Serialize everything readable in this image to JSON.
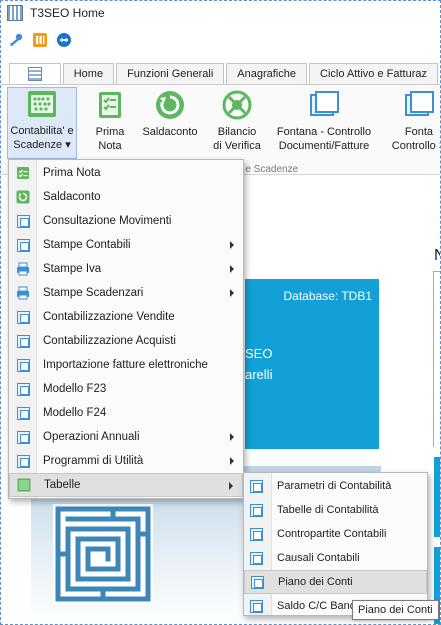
{
  "window": {
    "title": "T3SEO Home"
  },
  "quick_access": [
    {
      "icon": "key-icon"
    },
    {
      "icon": "bookmarks-icon"
    },
    {
      "icon": "remote-assistance-icon"
    }
  ],
  "ribbon_tabs": [
    {
      "label": "Home"
    },
    {
      "label": "Funzioni Generali"
    },
    {
      "label": "Anagrafiche"
    },
    {
      "label": "Ciclo Attivo e Fatturaz"
    }
  ],
  "ribbon": {
    "buttons": [
      {
        "line1": "Contabilita' e",
        "line2": "Scadenze ▾",
        "icon": "abacus-icon",
        "active": true
      },
      {
        "line1": "Prima",
        "line2": "Nota",
        "icon": "checklist-icon"
      },
      {
        "line1": "Saldaconto",
        "line2": "",
        "icon": "refresh-circle-icon"
      },
      {
        "line1": "Bilancio",
        "line2": "di Verifica",
        "icon": "balance-icon"
      },
      {
        "line1": "Fontana - Controllo",
        "line2": "Documenti/Fatture",
        "icon": "window-icon"
      },
      {
        "line1": "Fonta",
        "line2": "Controllo S",
        "icon": "window-icon"
      }
    ],
    "group_label": "a e Scadenze"
  },
  "background": {
    "database_label": "Database: TDB1",
    "card_line1": "SEO",
    "card_line2": "arelli",
    "right_letter": "N"
  },
  "menu": {
    "items": [
      {
        "label": "Prima Nota",
        "icon": "checklist-icon",
        "submenu": false
      },
      {
        "label": "Saldaconto",
        "icon": "refresh-circle-icon",
        "submenu": false
      },
      {
        "label": "Consultazione Movimenti",
        "icon": "window-icon",
        "submenu": false
      },
      {
        "label": "Stampe Contabili",
        "icon": "window-icon",
        "submenu": true
      },
      {
        "label": "Stampe Iva",
        "icon": "printer-icon",
        "submenu": true
      },
      {
        "label": "Stampe Scadenzari",
        "icon": "printer-icon",
        "submenu": true
      },
      {
        "label": "Contabilizzazione Vendite",
        "icon": "window-icon",
        "submenu": false
      },
      {
        "label": "Contabilizzazione Acquisti",
        "icon": "window-icon",
        "submenu": false
      },
      {
        "label": "Importazione fatture elettroniche",
        "icon": "window-icon",
        "submenu": false
      },
      {
        "label": "Modello F23",
        "icon": "window-icon",
        "submenu": false
      },
      {
        "label": "Modello F24",
        "icon": "window-icon",
        "submenu": false
      },
      {
        "label": "Operazioni Annuali",
        "icon": "window-icon",
        "submenu": true
      },
      {
        "label": "Programmi di Utilità",
        "icon": "window-icon",
        "submenu": true
      },
      {
        "label": "Tabelle",
        "icon": "table-icon",
        "submenu": true,
        "highlight": true
      }
    ]
  },
  "submenu": {
    "items": [
      {
        "label": "Parametri di Contabilità",
        "icon": "window-icon"
      },
      {
        "label": "Tabelle di Contabilità",
        "icon": "window-icon"
      },
      {
        "label": "Contropartite Contabili",
        "icon": "window-icon"
      },
      {
        "label": "Causali Contabili",
        "icon": "window-icon"
      },
      {
        "label": "Piano dei Conti",
        "icon": "window-icon",
        "highlight": true
      },
      {
        "label": "Saldo C/C Banc",
        "icon": "window-icon"
      }
    ]
  },
  "tooltip": {
    "text": "Piano dei Conti"
  },
  "colors": {
    "accent": "#12a0d6",
    "menu_bg": "#fbfbfb",
    "highlight": "#e0e0e0",
    "green_icon": "#5cb85c"
  }
}
